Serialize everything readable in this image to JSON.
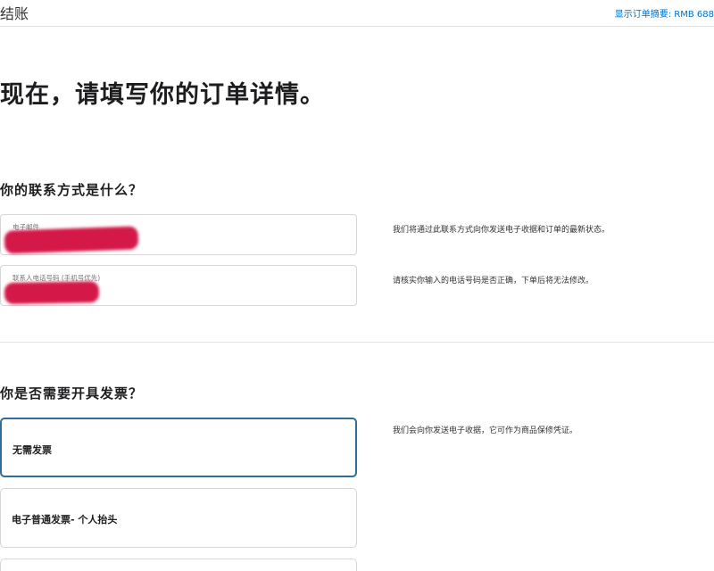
{
  "header": {
    "title": "结账",
    "summary_link": "显示订单摘要: RMB 688"
  },
  "headline": "现在，请填写你的订单详情。",
  "contact": {
    "title": "你的联系方式是什么？",
    "email": {
      "label": "电子邮件",
      "hint": "我们将通过此联系方式向你发送电子收据和订单的最新状态。"
    },
    "phone": {
      "label": "联系人电话号码 (手机号优先)",
      "hint": "请核实你输入的电话号码是否正确，下单后将无法修改。"
    }
  },
  "invoice": {
    "title": "你是否需要开具发票？",
    "hint": "我们会向你发送电子收据，它可作为商品保修凭证。",
    "options": [
      {
        "label": "无需发票",
        "selected": true
      },
      {
        "label": "电子普通发票- 个人抬头",
        "selected": false
      },
      {
        "label": "",
        "selected": false
      }
    ]
  },
  "colors": {
    "link": "#0070c9",
    "selected_border": "#2e6e98",
    "redaction": "#d1063a"
  }
}
